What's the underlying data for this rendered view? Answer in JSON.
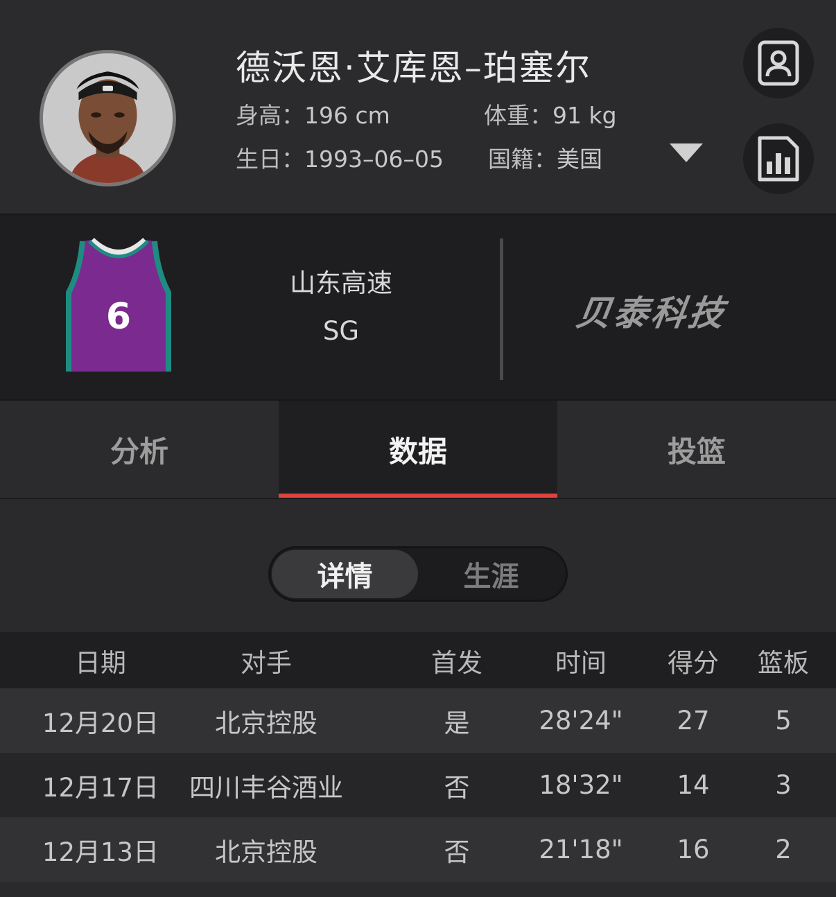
{
  "player": {
    "name": "德沃恩·艾库恩–珀塞尔",
    "height_label": "身高：",
    "height_value": "196 cm",
    "weight_label": "体重：",
    "weight_value": "91 kg",
    "birth_label": "生日：",
    "birth_value": "1993–06–05",
    "nation_label": "国籍：",
    "nation_value": "美国"
  },
  "icons": {
    "profile": "person-card-icon",
    "stats": "bar-chart-icon",
    "expand": "triangle-down-icon"
  },
  "team": {
    "name": "山东高速",
    "position": "SG",
    "jersey_number": "6",
    "jersey_color": "#7b2a8f",
    "jersey_trim": "#1f8c82",
    "brand": "贝泰科技"
  },
  "tabs": [
    {
      "label": "分析",
      "active": false
    },
    {
      "label": "数据",
      "active": true
    },
    {
      "label": "投篮",
      "active": false
    }
  ],
  "accent_color": "#e0433f",
  "segment": [
    {
      "label": "详情",
      "active": true
    },
    {
      "label": "生涯",
      "active": false
    }
  ],
  "table": {
    "headers": [
      "日期",
      "对手",
      "首发",
      "时间",
      "得分",
      "篮板"
    ],
    "rows": [
      [
        "12月20日",
        "北京控股",
        "是",
        "28'24\"",
        "27",
        "5"
      ],
      [
        "12月17日",
        "四川丰谷酒业",
        "否",
        "18'32\"",
        "14",
        "3"
      ],
      [
        "12月13日",
        "北京控股",
        "否",
        "21'18\"",
        "16",
        "2"
      ]
    ]
  }
}
